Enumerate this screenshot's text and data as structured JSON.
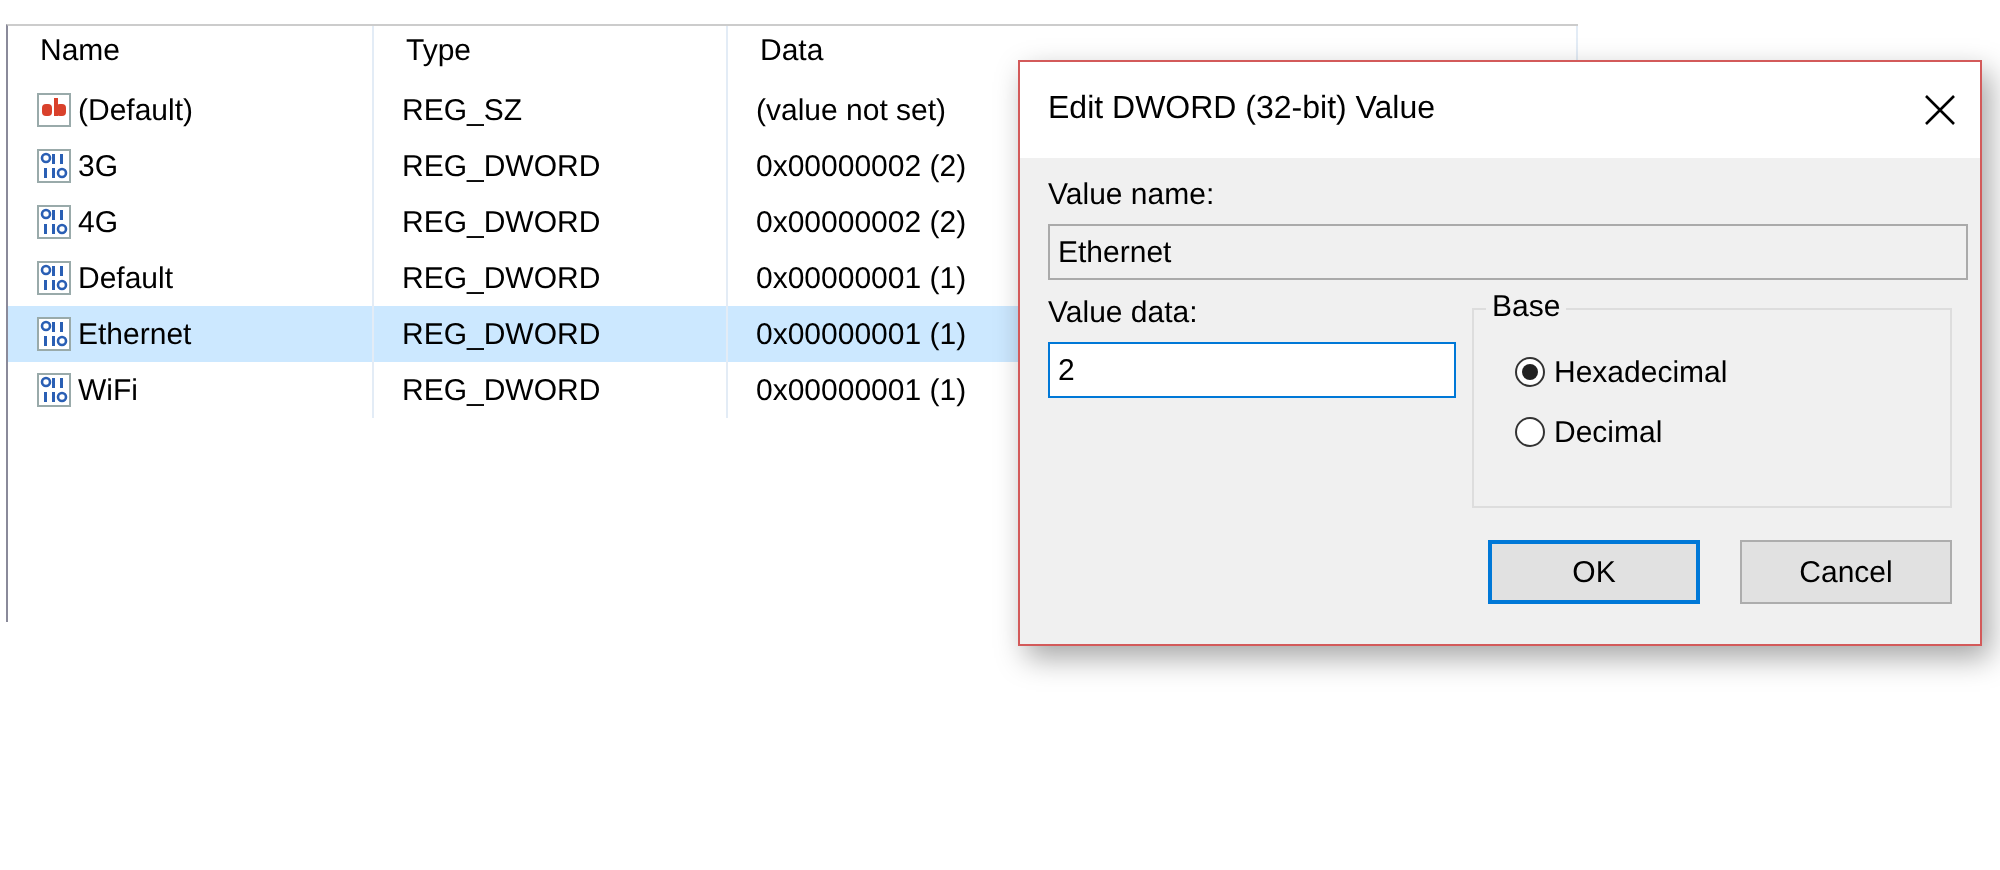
{
  "columns": [
    {
      "label": "Name"
    },
    {
      "label": "Type"
    },
    {
      "label": "Data"
    }
  ],
  "rows": [
    {
      "kind": "string",
      "name": "(Default)",
      "type": "REG_SZ",
      "data": "(value not set)",
      "selected": false
    },
    {
      "kind": "dword",
      "name": "3G",
      "type": "REG_DWORD",
      "data": "0x00000002 (2)",
      "selected": false
    },
    {
      "kind": "dword",
      "name": "4G",
      "type": "REG_DWORD",
      "data": "0x00000002 (2)",
      "selected": false
    },
    {
      "kind": "dword",
      "name": "Default",
      "type": "REG_DWORD",
      "data": "0x00000001 (1)",
      "selected": false
    },
    {
      "kind": "dword",
      "name": "Ethernet",
      "type": "REG_DWORD",
      "data": "0x00000001 (1)",
      "selected": true
    },
    {
      "kind": "dword",
      "name": "WiFi",
      "type": "REG_DWORD",
      "data": "0x00000001 (1)",
      "selected": false
    }
  ],
  "dialog": {
    "title": "Edit DWORD (32-bit) Value",
    "value_name_label": "Value name:",
    "value_name": "Ethernet",
    "value_data_label": "Value data:",
    "value_data": "2",
    "base_label": "Base",
    "base_options": [
      {
        "label": "Hexadecimal",
        "selected": true
      },
      {
        "label": "Decimal",
        "selected": false
      }
    ],
    "buttons": [
      {
        "label": "OK",
        "default": true
      },
      {
        "label": "Cancel",
        "default": false
      }
    ]
  }
}
